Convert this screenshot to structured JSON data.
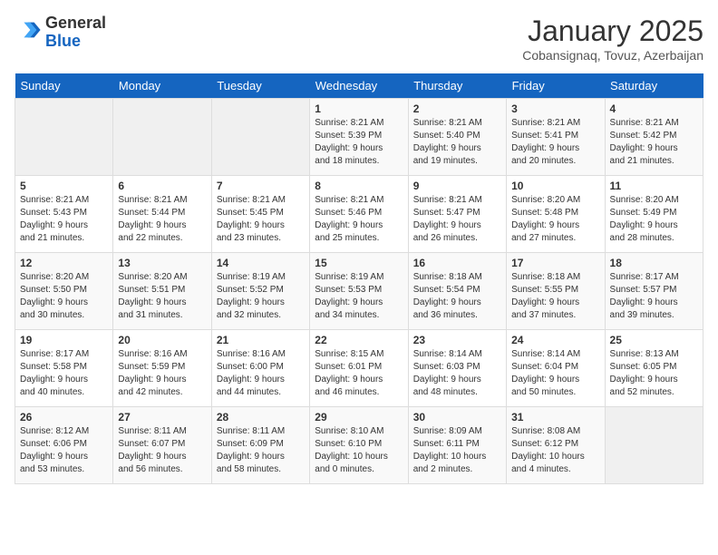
{
  "header": {
    "logo_line1": "General",
    "logo_line2": "Blue",
    "month": "January 2025",
    "location": "Cobansignaq, Tovuz, Azerbaijan"
  },
  "days_of_week": [
    "Sunday",
    "Monday",
    "Tuesday",
    "Wednesday",
    "Thursday",
    "Friday",
    "Saturday"
  ],
  "weeks": [
    [
      {
        "day": "",
        "info": ""
      },
      {
        "day": "",
        "info": ""
      },
      {
        "day": "",
        "info": ""
      },
      {
        "day": "1",
        "info": "Sunrise: 8:21 AM\nSunset: 5:39 PM\nDaylight: 9 hours\nand 18 minutes."
      },
      {
        "day": "2",
        "info": "Sunrise: 8:21 AM\nSunset: 5:40 PM\nDaylight: 9 hours\nand 19 minutes."
      },
      {
        "day": "3",
        "info": "Sunrise: 8:21 AM\nSunset: 5:41 PM\nDaylight: 9 hours\nand 20 minutes."
      },
      {
        "day": "4",
        "info": "Sunrise: 8:21 AM\nSunset: 5:42 PM\nDaylight: 9 hours\nand 21 minutes."
      }
    ],
    [
      {
        "day": "5",
        "info": "Sunrise: 8:21 AM\nSunset: 5:43 PM\nDaylight: 9 hours\nand 21 minutes."
      },
      {
        "day": "6",
        "info": "Sunrise: 8:21 AM\nSunset: 5:44 PM\nDaylight: 9 hours\nand 22 minutes."
      },
      {
        "day": "7",
        "info": "Sunrise: 8:21 AM\nSunset: 5:45 PM\nDaylight: 9 hours\nand 23 minutes."
      },
      {
        "day": "8",
        "info": "Sunrise: 8:21 AM\nSunset: 5:46 PM\nDaylight: 9 hours\nand 25 minutes."
      },
      {
        "day": "9",
        "info": "Sunrise: 8:21 AM\nSunset: 5:47 PM\nDaylight: 9 hours\nand 26 minutes."
      },
      {
        "day": "10",
        "info": "Sunrise: 8:20 AM\nSunset: 5:48 PM\nDaylight: 9 hours\nand 27 minutes."
      },
      {
        "day": "11",
        "info": "Sunrise: 8:20 AM\nSunset: 5:49 PM\nDaylight: 9 hours\nand 28 minutes."
      }
    ],
    [
      {
        "day": "12",
        "info": "Sunrise: 8:20 AM\nSunset: 5:50 PM\nDaylight: 9 hours\nand 30 minutes."
      },
      {
        "day": "13",
        "info": "Sunrise: 8:20 AM\nSunset: 5:51 PM\nDaylight: 9 hours\nand 31 minutes."
      },
      {
        "day": "14",
        "info": "Sunrise: 8:19 AM\nSunset: 5:52 PM\nDaylight: 9 hours\nand 32 minutes."
      },
      {
        "day": "15",
        "info": "Sunrise: 8:19 AM\nSunset: 5:53 PM\nDaylight: 9 hours\nand 34 minutes."
      },
      {
        "day": "16",
        "info": "Sunrise: 8:18 AM\nSunset: 5:54 PM\nDaylight: 9 hours\nand 36 minutes."
      },
      {
        "day": "17",
        "info": "Sunrise: 8:18 AM\nSunset: 5:55 PM\nDaylight: 9 hours\nand 37 minutes."
      },
      {
        "day": "18",
        "info": "Sunrise: 8:17 AM\nSunset: 5:57 PM\nDaylight: 9 hours\nand 39 minutes."
      }
    ],
    [
      {
        "day": "19",
        "info": "Sunrise: 8:17 AM\nSunset: 5:58 PM\nDaylight: 9 hours\nand 40 minutes."
      },
      {
        "day": "20",
        "info": "Sunrise: 8:16 AM\nSunset: 5:59 PM\nDaylight: 9 hours\nand 42 minutes."
      },
      {
        "day": "21",
        "info": "Sunrise: 8:16 AM\nSunset: 6:00 PM\nDaylight: 9 hours\nand 44 minutes."
      },
      {
        "day": "22",
        "info": "Sunrise: 8:15 AM\nSunset: 6:01 PM\nDaylight: 9 hours\nand 46 minutes."
      },
      {
        "day": "23",
        "info": "Sunrise: 8:14 AM\nSunset: 6:03 PM\nDaylight: 9 hours\nand 48 minutes."
      },
      {
        "day": "24",
        "info": "Sunrise: 8:14 AM\nSunset: 6:04 PM\nDaylight: 9 hours\nand 50 minutes."
      },
      {
        "day": "25",
        "info": "Sunrise: 8:13 AM\nSunset: 6:05 PM\nDaylight: 9 hours\nand 52 minutes."
      }
    ],
    [
      {
        "day": "26",
        "info": "Sunrise: 8:12 AM\nSunset: 6:06 PM\nDaylight: 9 hours\nand 53 minutes."
      },
      {
        "day": "27",
        "info": "Sunrise: 8:11 AM\nSunset: 6:07 PM\nDaylight: 9 hours\nand 56 minutes."
      },
      {
        "day": "28",
        "info": "Sunrise: 8:11 AM\nSunset: 6:09 PM\nDaylight: 9 hours\nand 58 minutes."
      },
      {
        "day": "29",
        "info": "Sunrise: 8:10 AM\nSunset: 6:10 PM\nDaylight: 10 hours\nand 0 minutes."
      },
      {
        "day": "30",
        "info": "Sunrise: 8:09 AM\nSunset: 6:11 PM\nDaylight: 10 hours\nand 2 minutes."
      },
      {
        "day": "31",
        "info": "Sunrise: 8:08 AM\nSunset: 6:12 PM\nDaylight: 10 hours\nand 4 minutes."
      },
      {
        "day": "",
        "info": ""
      }
    ]
  ]
}
